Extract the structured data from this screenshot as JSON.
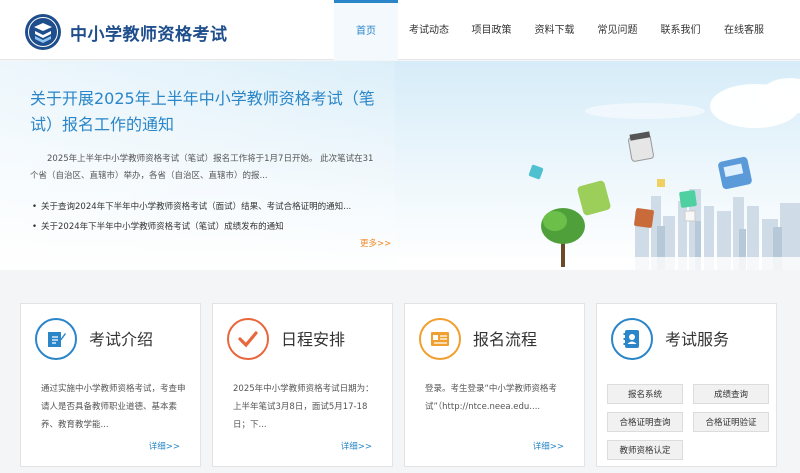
{
  "header": {
    "site_title": "中小学教师资格考试",
    "nav": [
      "首页",
      "考试动态",
      "项目政策",
      "资料下载",
      "常见问题",
      "联系我们",
      "在线客服"
    ],
    "active_index": 0
  },
  "banner": {
    "headline": "关于开展2025年上半年中小学教师资格考试（笔试）报名工作的通知",
    "summary": "2025年上半年中小学教师资格考试（笔试）报名工作将于1月7日开始。  此次笔试在31个省（自治区、直辖市）举办，各省（自治区、直辖市）的报...",
    "bullets": [
      "关于查询2024年下半年中小学教师资格考试（面试）结果、考试合格证明的通知...",
      "关于2024年下半年中小学教师资格考试（笔试）成绩发布的通知"
    ],
    "more": "更多>>"
  },
  "cards": [
    {
      "title": "考试介绍",
      "icon": "edit-document-icon",
      "color": "#2a86c8",
      "text": "通过实施中小学教师资格考试，考查申请人是否具备教师职业道德、基本素养、教育教学能...",
      "more": "详细>>"
    },
    {
      "title": "日程安排",
      "icon": "checkmark-icon",
      "color": "#e8673c",
      "text": "2025年中小学教师资格考试日期为：上半年笔试3月8日，面试5月17-18日；下...",
      "more": "详细>>"
    },
    {
      "title": "报名流程",
      "icon": "registration-form-icon",
      "color": "#f0a030",
      "text": "登录。考生登录“中小学教师资格考试”（http://ntce.neea.edu....",
      "more": "详细>>"
    },
    {
      "title": "考试服务",
      "icon": "contact-card-icon",
      "color": "#2a86c8",
      "services": [
        "报名系统",
        "成绩查询",
        "合格证明查询",
        "合格证明验证",
        "教师资格认定"
      ]
    }
  ]
}
